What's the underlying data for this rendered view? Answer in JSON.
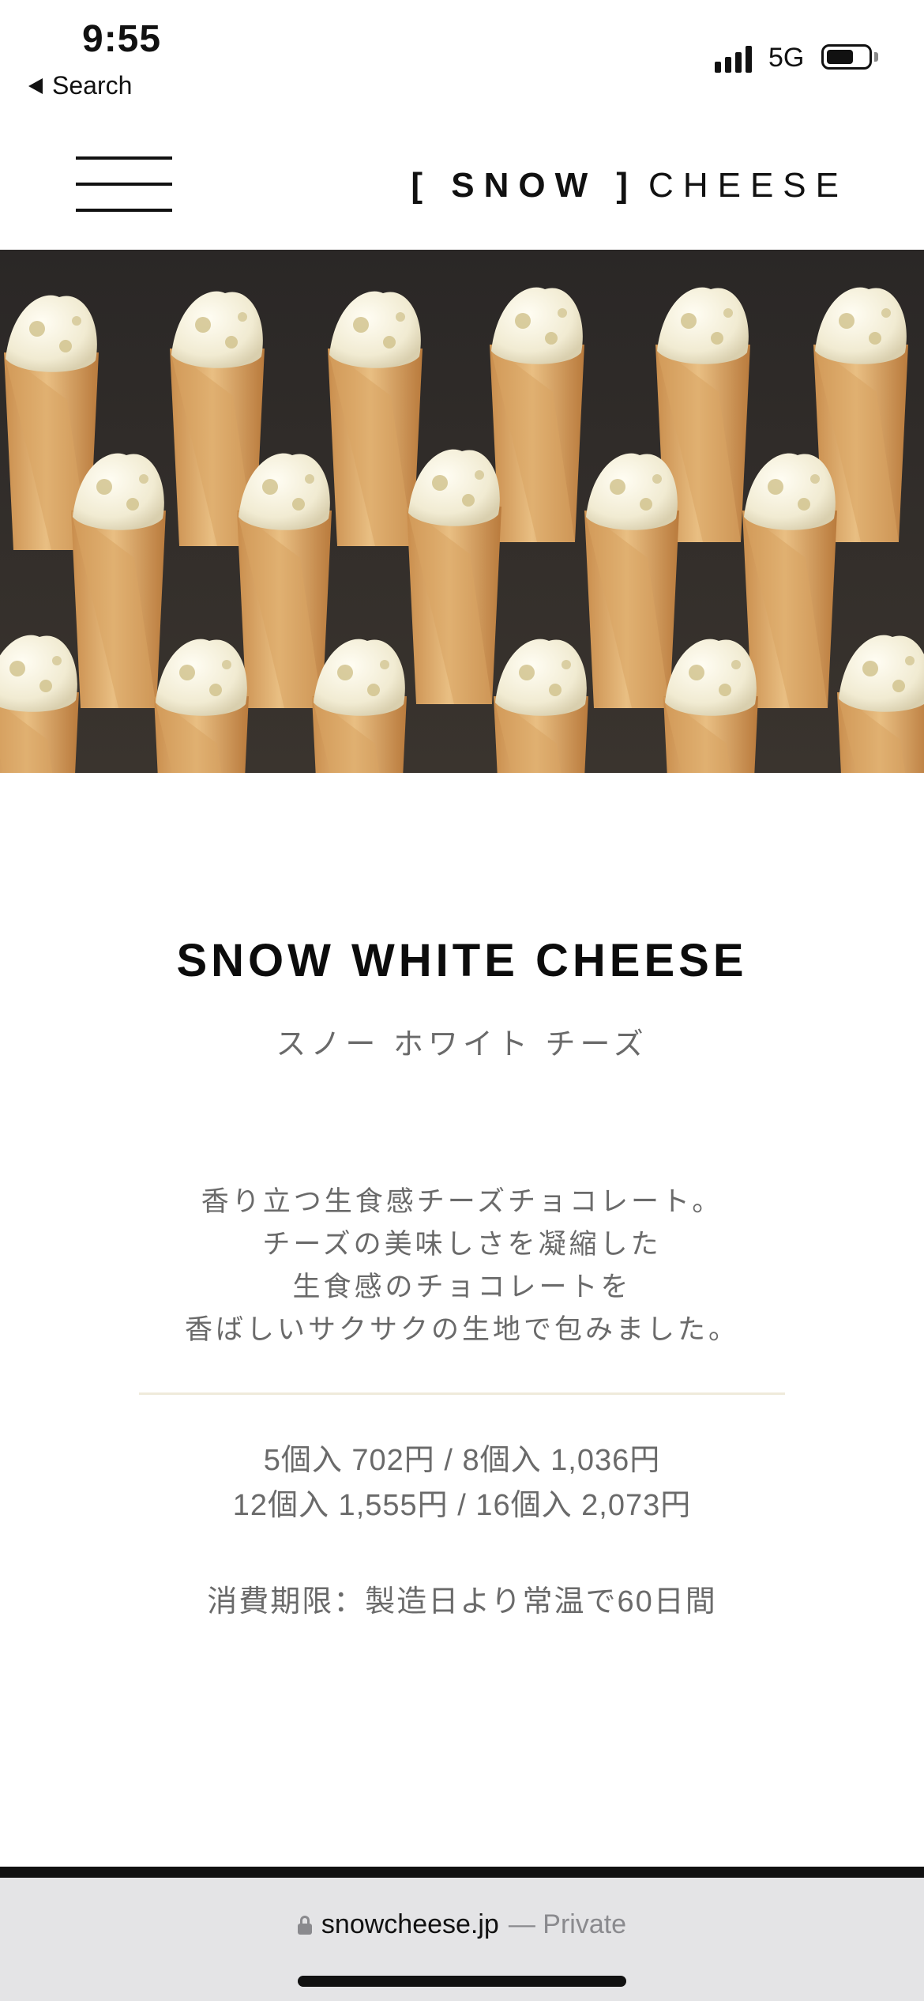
{
  "status_bar": {
    "time": "9:55",
    "back_label": "Search",
    "network": "5G",
    "battery_level": 0.65
  },
  "header": {
    "menu_icon": "hamburger-menu-icon",
    "logo_snow": "[ SNOW ]",
    "logo_cheese": "CHEESE"
  },
  "hero": {
    "image_description": "photo-of-cheese-filled-langue-de-chat-cones"
  },
  "product": {
    "title": "SNOW WHITE CHEESE",
    "kana": "スノー ホワイト チーズ",
    "description": [
      "香り立つ生食感チーズチョコレート。",
      "チーズの美味しさを凝縮した",
      "生食感のチョコレートを",
      "香ばしいサクサクの生地で包みました。"
    ],
    "prices": [
      "5個入 702円 / 8個入 1,036円",
      "12個入 1,555円 / 16個入 2,073円"
    ],
    "expiry": "消費期限：製造日より常温で60日間"
  },
  "browser": {
    "domain": "snowcheese.jp",
    "private_label": "— Private"
  },
  "colors": {
    "divider": "#efeadb",
    "text_gray": "#6a6a6a",
    "url_bar": "#e4e4e6"
  }
}
